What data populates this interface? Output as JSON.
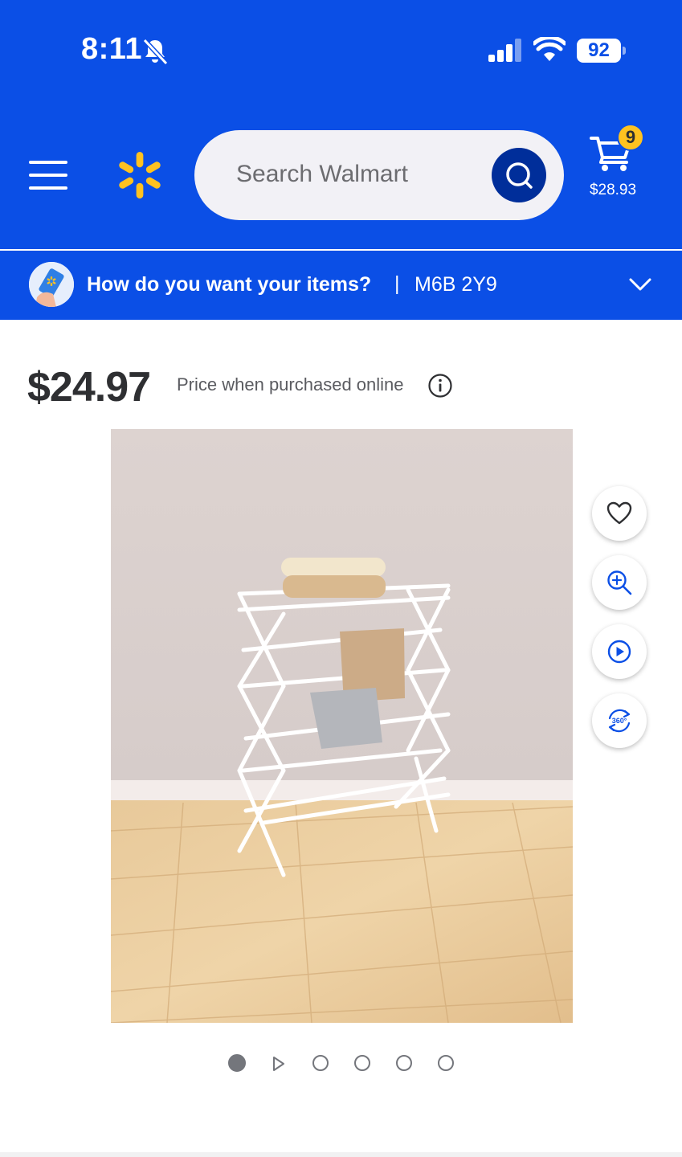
{
  "status_bar": {
    "time": "8:11",
    "battery": "92",
    "icons": [
      "bell-slash-icon",
      "cellular-signal-icon",
      "wifi-icon",
      "battery-icon"
    ]
  },
  "header": {
    "menu_icon": "hamburger-menu-icon",
    "logo_icon": "walmart-spark-icon",
    "search_placeholder": "Search Walmart",
    "search_icon": "search-icon",
    "cart_icon": "shopping-cart-icon",
    "cart_count": "9",
    "cart_total": "$28.93",
    "brand_color": "#0b4fe6",
    "accent_color": "#ffc220"
  },
  "delivery": {
    "question": "How do you want your items?",
    "separator": "|",
    "postal_code": "M6B 2Y9",
    "chevron_icon": "chevron-down-icon"
  },
  "product": {
    "price": "$24.97",
    "price_note": "Price when purchased online",
    "info_icon": "info-icon",
    "image_alt": "White folding clothes drying rack with towels",
    "actions": [
      {
        "name": "favorite",
        "icon": "heart-icon"
      },
      {
        "name": "zoom",
        "icon": "zoom-in-icon"
      },
      {
        "name": "video",
        "icon": "play-icon"
      },
      {
        "name": "view-360",
        "icon": "rotate-360-icon"
      }
    ],
    "carousel": {
      "count": 6,
      "active_index": 0,
      "video_index": 1
    }
  }
}
